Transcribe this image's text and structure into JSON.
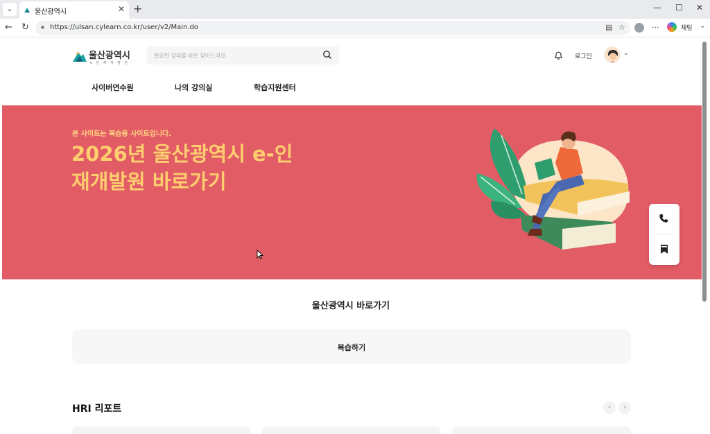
{
  "browser": {
    "tab_title": "울산광역시",
    "tab_close": "✕",
    "new_tab": "+",
    "url": "https://ulsan.cylearn.co.kr/user/v2/Main.do",
    "chat_label": "채팅",
    "window_controls": [
      "—",
      "☐",
      "✕"
    ]
  },
  "header": {
    "logo_name": "울산광역시",
    "logo_sub": "e·인·재·개·발·원",
    "search_placeholder": "필요한 강의를 바로 찾아드려요.",
    "login_label": "로그인"
  },
  "nav": {
    "items": [
      "사이버연수원",
      "나의 강의실",
      "학습지원센터"
    ]
  },
  "hero": {
    "notice": "본 사이트는 복습용 사이트입니다.",
    "headline": "2026년 울산광역시 e-인재개발원 바로가기",
    "bg_color": "#e25c66",
    "text_color": "#ffce6e"
  },
  "quick_menu": {
    "icons": [
      "phone-icon",
      "bookmark-icon"
    ]
  },
  "shortcut_section": {
    "title": "울산광역시 바로가기",
    "review_label": "복습하기"
  },
  "hri": {
    "title": "HRI 리포트",
    "prev": "‹",
    "next": "›"
  }
}
